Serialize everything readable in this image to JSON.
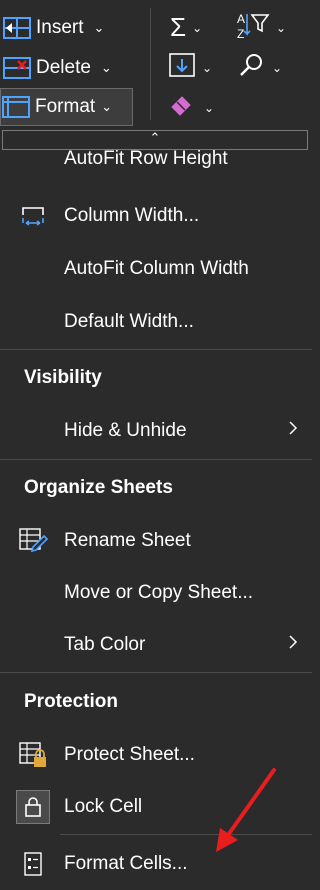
{
  "ribbon": {
    "insert_label": "Insert",
    "delete_label": "Delete",
    "format_label": "Format"
  },
  "menu": {
    "autofit_row_height": "AutoFit Row Height",
    "column_width": "Column Width...",
    "autofit_column_width": "AutoFit Column Width",
    "default_width": "Default Width...",
    "visibility_header": "Visibility",
    "hide_unhide": "Hide & Unhide",
    "organize_header": "Organize Sheets",
    "rename_sheet": "Rename Sheet",
    "move_copy_sheet": "Move or Copy Sheet...",
    "tab_color": "Tab Color",
    "protection_header": "Protection",
    "protect_sheet": "Protect Sheet...",
    "lock_cell": "Lock Cell",
    "format_cells": "Format Cells..."
  },
  "colors": {
    "background": "#2b2b2b",
    "accent_blue": "#4ea3ff",
    "arrow_red": "#e81e1e",
    "eraser_pink": "#d36bd1"
  }
}
